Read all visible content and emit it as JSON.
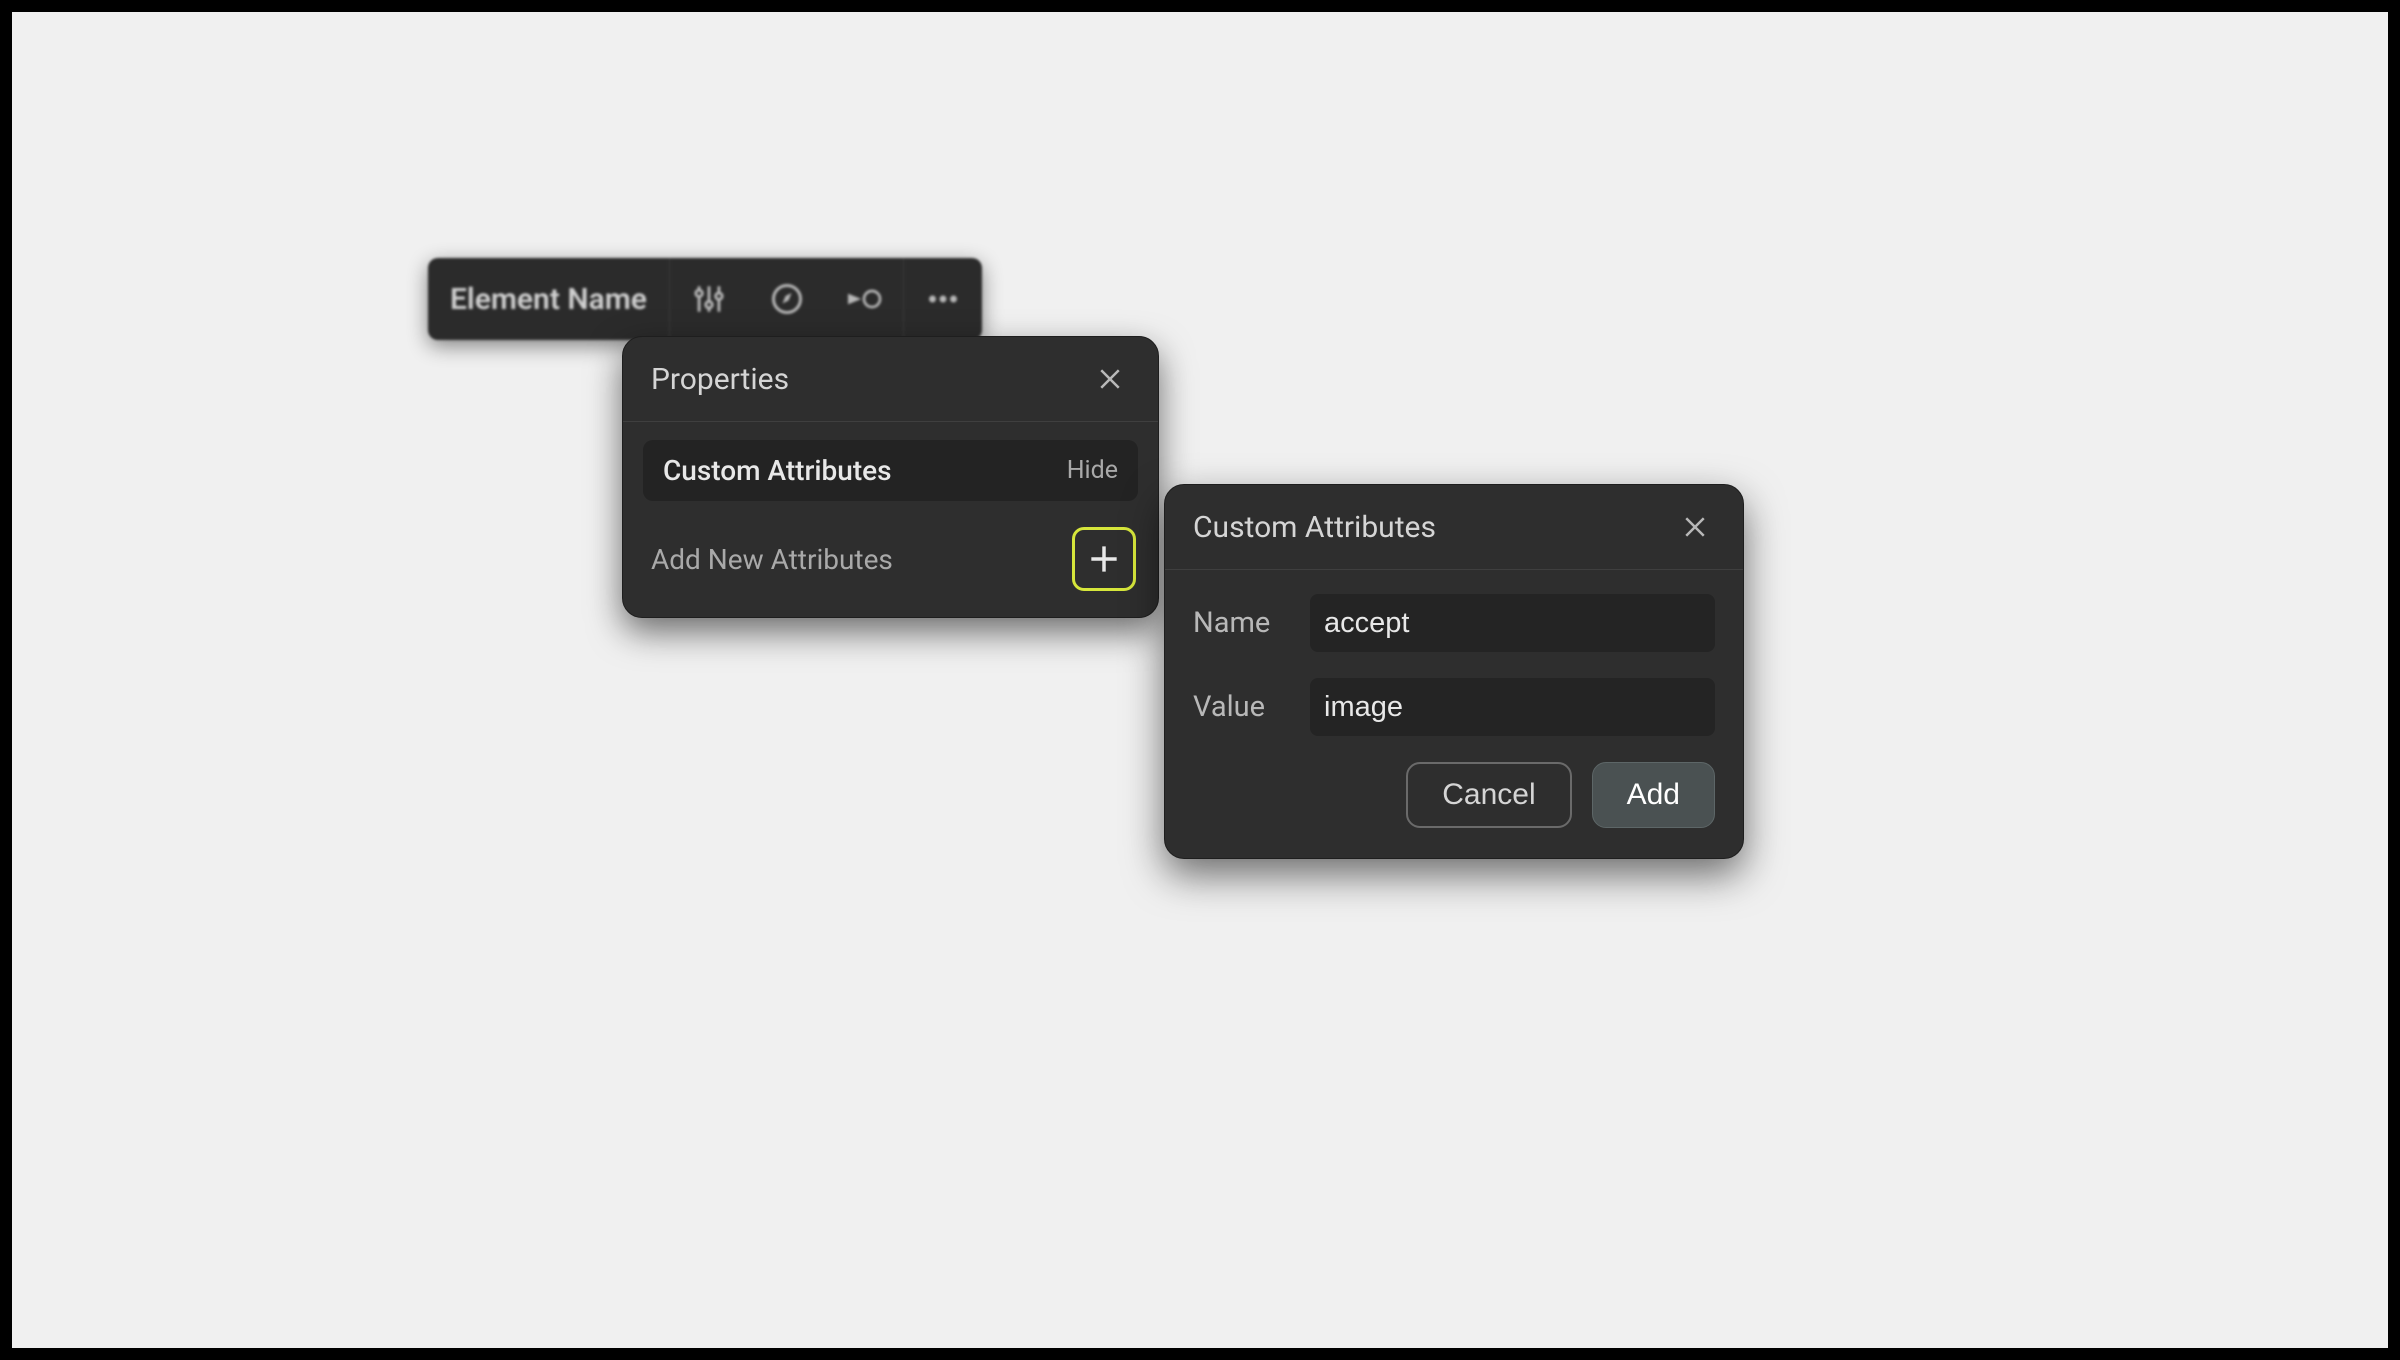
{
  "toolbar": {
    "element_label": "Element Name",
    "icons": {
      "sliders": "sliders-icon",
      "compass": "compass-icon",
      "connector": "connector-icon",
      "more": "more-icon"
    }
  },
  "properties_panel": {
    "title": "Properties",
    "section": {
      "title": "Custom Attributes",
      "toggle_label": "Hide"
    },
    "add_row_label": "Add New Attributes"
  },
  "attr_dialog": {
    "title": "Custom Attributes",
    "name_label": "Name",
    "value_label": "Value",
    "name_value": "accept",
    "value_value": "image",
    "cancel_label": "Cancel",
    "add_label": "Add"
  }
}
